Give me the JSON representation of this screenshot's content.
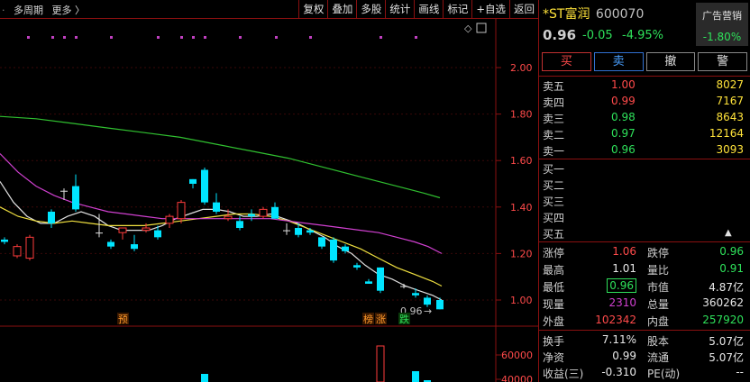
{
  "toolbar": {
    "left_items": [
      "多周期",
      "更多 〉"
    ],
    "buttons": [
      "复权",
      "叠加",
      "多股",
      "统计",
      "画线",
      "标记",
      "+自选",
      "返回"
    ]
  },
  "price_axis": [
    "2.00",
    "1.80",
    "1.60",
    "1.40",
    "1.20",
    "1.00"
  ],
  "volume_axis": [
    "60000",
    "40000"
  ],
  "chart_labels": {
    "low_label": "0.96",
    "low_arrow": "→",
    "tag_yu": "预",
    "tag_bang": "榜",
    "tag_zhang": "涨",
    "tag_die": "跌"
  },
  "stock": {
    "name": "*ST富润",
    "code": "600070",
    "ad_label": "广告营销",
    "ad_change": "-1.80%",
    "price": "0.96",
    "change": "-0.05",
    "change_pct": "-4.95%"
  },
  "trade_buttons": [
    "买",
    "卖",
    "撤",
    "警"
  ],
  "sells": [
    {
      "label": "卖五",
      "price": "1.00",
      "vol": "8027"
    },
    {
      "label": "卖四",
      "price": "0.99",
      "vol": "7167"
    },
    {
      "label": "卖三",
      "price": "0.98",
      "vol": "8643"
    },
    {
      "label": "卖二",
      "price": "0.97",
      "vol": "12164"
    },
    {
      "label": "卖一",
      "price": "0.96",
      "vol": "3093"
    }
  ],
  "buys": [
    {
      "label": "买一"
    },
    {
      "label": "买二"
    },
    {
      "label": "买三"
    },
    {
      "label": "买四"
    },
    {
      "label": "买五"
    }
  ],
  "stats": [
    {
      "l1": "涨停",
      "v1": "1.06",
      "l2": "跌停",
      "v2": "0.96"
    },
    {
      "l1": "最高",
      "v1": "1.01",
      "l2": "量比",
      "v2": "0.91"
    },
    {
      "l1": "最低",
      "v1": "0.96",
      "l2": "市值",
      "v2": "4.87亿"
    },
    {
      "l1": "现量",
      "v1": "2310",
      "l2": "总量",
      "v2": "360262"
    },
    {
      "l1": "外盘",
      "v1": "102342",
      "l2": "内盘",
      "v2": "257920"
    }
  ],
  "stats2": [
    {
      "l1": "换手",
      "v1": "7.11%",
      "l2": "股本",
      "v2": "5.07亿"
    },
    {
      "l1": "净资",
      "v1": "0.99",
      "l2": "流通",
      "v2": "5.07亿"
    },
    {
      "l1": "收益(三)",
      "v1": "-0.310",
      "l2": "PE(动)",
      "v2": "--"
    }
  ],
  "colors": {
    "up": "#ff3c3c",
    "down": "#00e5ff",
    "ma_white": "#e0e0e0",
    "ma_yellow": "#f0e040",
    "ma_magenta": "#d040d0",
    "ma_green": "#30c030",
    "grid": "#8a1010"
  }
}
